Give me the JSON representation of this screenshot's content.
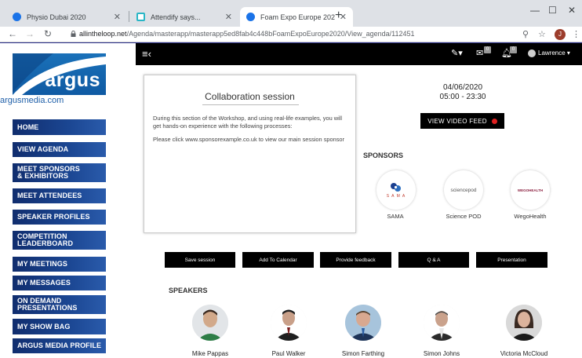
{
  "browser": {
    "tabs": [
      {
        "title": "Physio Dubai 2020",
        "color": "#1a73e8"
      },
      {
        "title": "Attendify says...",
        "color": "#29b6c6"
      },
      {
        "title": "Foam Expo Europe 2020",
        "color": "#1a73e8"
      }
    ],
    "url_host": "allintheloop.net",
    "url_path": "/Agenda/masterapp/masterapp5ed8fab4c448bFoamExpoEurope2020/View_agenda/112451",
    "profile_letter": "J"
  },
  "sidebar": {
    "logo_text": "argus",
    "site_text": "argusmedia.com",
    "items": [
      {
        "label": "HOME"
      },
      {
        "label": "VIEW AGENDA"
      },
      {
        "label": "MEET SPONSORS\n& EXHIBITORS"
      },
      {
        "label": "MEET ATTENDEES"
      },
      {
        "label": "SPEAKER PROFILES"
      },
      {
        "label": "COMPETITION\nLEADERBOARD"
      },
      {
        "label": "MY MEETINGS"
      },
      {
        "label": "MY MESSAGES"
      },
      {
        "label": "ON DEMAND\nPRESENTATIONS"
      },
      {
        "label": "MY SHOW BAG"
      },
      {
        "label": "ARGUS MEDIA PROFILE"
      }
    ]
  },
  "topbar": {
    "message_count": "0",
    "notification_count": "0",
    "user_name": "Lawrence"
  },
  "session": {
    "title": "Collaboration session",
    "description": "During this section of the Workshop, and using real-life examples, you will get hands-on experience with the following processes:",
    "link_text": "Please click www.sponsorexample.co.uk to view our main session sponsor",
    "date": "04/06/2020",
    "time": "05:00 - 23:30",
    "video_label": "VIEW VIDEO FEED"
  },
  "sponsors": {
    "title": "SPONSORS",
    "items": [
      {
        "name": "SAMA",
        "logo_text": "S A M A"
      },
      {
        "name": "Science POD",
        "logo_text": "sciencepod"
      },
      {
        "name": "WegoHealth",
        "logo_text": "WEGOHEALTH"
      }
    ]
  },
  "actions": [
    {
      "label": "Save session"
    },
    {
      "label": "Add To Calendar"
    },
    {
      "label": "Provide feedback"
    },
    {
      "label": "Q & A"
    },
    {
      "label": "Presentation"
    }
  ],
  "speakers": {
    "title": "SPEAKERS",
    "items": [
      {
        "name": "Mike Pappas"
      },
      {
        "name": "Paul Walker"
      },
      {
        "name": "Simon Farthing"
      },
      {
        "name": "Simon Johns"
      },
      {
        "name": "Victoria McCloud"
      }
    ]
  }
}
